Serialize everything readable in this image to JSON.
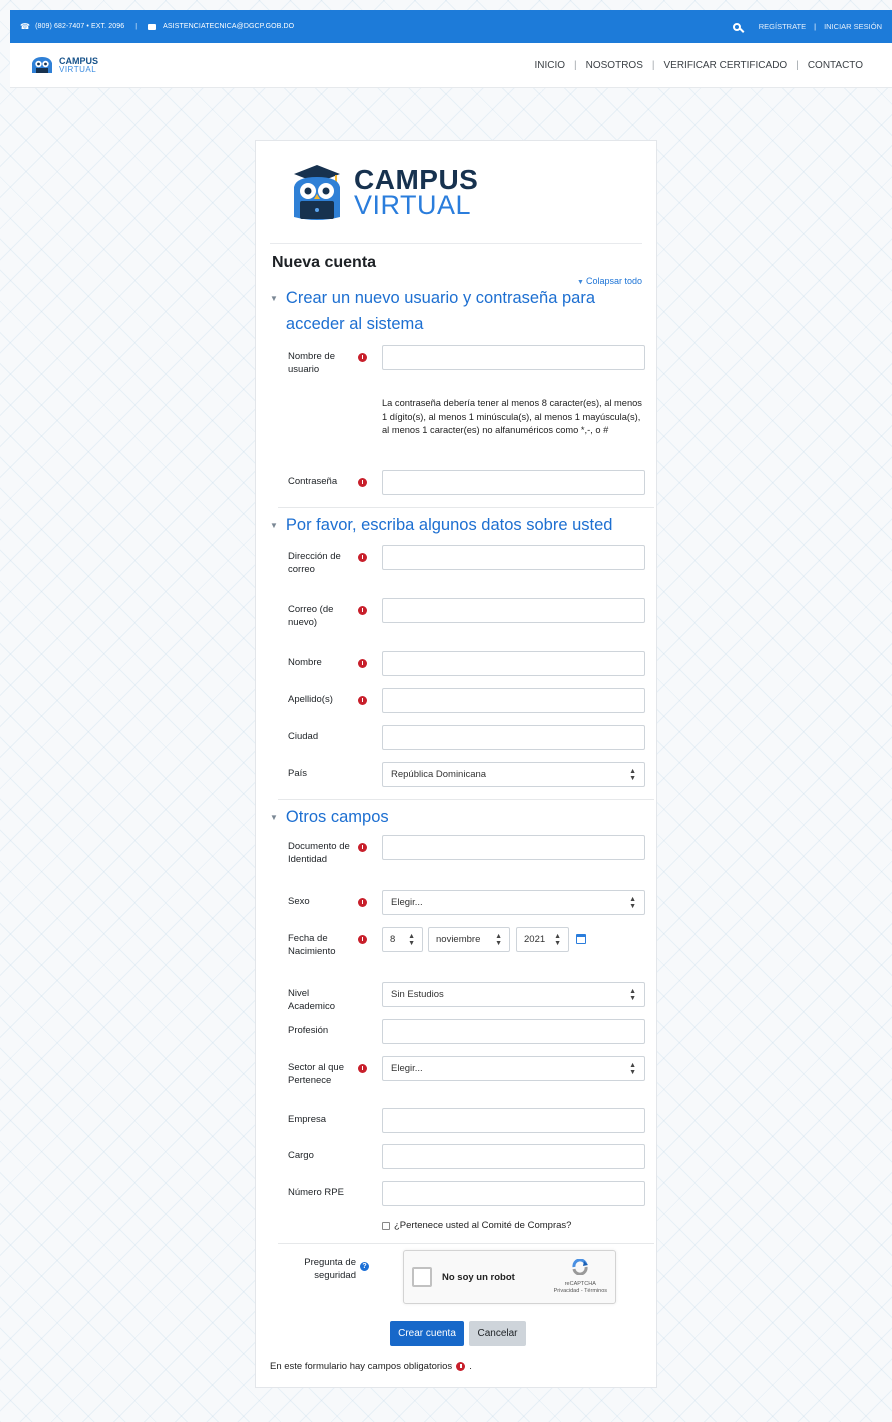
{
  "topbar": {
    "phone": "(809) 682-7407 • EXT. 2096",
    "separator": "|",
    "email": "ASISTENCIATECNICA@DGCP.GOB.DO",
    "register_label": "REGÍSTRATE",
    "login_label": "INICIAR SESIÓN",
    "right_separator": "|",
    "color": "#1d7bd9"
  },
  "navbar": {
    "brand_line1": "CAMPUS",
    "brand_line2": "VIRTUAL",
    "items": [
      "INICIO",
      "NOSOTROS",
      "VERIFICAR CERTIFICADO",
      "CONTACTO"
    ],
    "divider": "|"
  },
  "card": {
    "logo_line1": "CAMPUS",
    "logo_line2": "VIRTUAL",
    "title": "Nueva cuenta",
    "collapse_all": "Colapsar todo"
  },
  "sections": {
    "account": "Crear un nuevo usuario y contraseña para acceder al sistema",
    "about": "Por favor, escriba algunos datos sobre usted",
    "other": "Otros campos"
  },
  "fields": {
    "username": "Nombre de usuario",
    "password_note": "La contraseña debería tener al menos 8 caracter(es), al menos 1 dígito(s), al menos 1 minúscula(s), al menos 1 mayúscula(s), al menos 1 caracter(es) no alfanuméricos como *,-, o #",
    "password": "Contraseña",
    "email": "Dirección de correo",
    "email2": "Correo (de nuevo)",
    "firstname": "Nombre",
    "lastname": "Apellido(s)",
    "city": "Ciudad",
    "country": "País",
    "country_value": "República Dominicana",
    "id_document": "Documento de Identidad",
    "sex": "Sexo",
    "sex_value": "Elegir...",
    "birthdate": "Fecha de Nacimiento",
    "birth_day": "8",
    "birth_month": "noviembre",
    "birth_year": "2021",
    "academic_level": "Nivel Academico",
    "academic_value": "Sin Estudios",
    "profession": "Profesión",
    "sector": "Sector al que Pertenece",
    "sector_value": "Elegir...",
    "company": "Empresa",
    "position": "Cargo",
    "rpe": "Número RPE",
    "committee_check": "¿Pertenece usted al Comité de Compras?",
    "security_question": "Pregunta de seguridad"
  },
  "recaptcha": {
    "label": "No soy un robot",
    "brand": "reCAPTCHA",
    "links": "Privacidad - Términos"
  },
  "buttons": {
    "create": "Crear cuenta",
    "cancel": "Cancelar"
  },
  "footer": {
    "required_note": "En este formulario hay campos obligatorios",
    "trailing_period": "."
  }
}
